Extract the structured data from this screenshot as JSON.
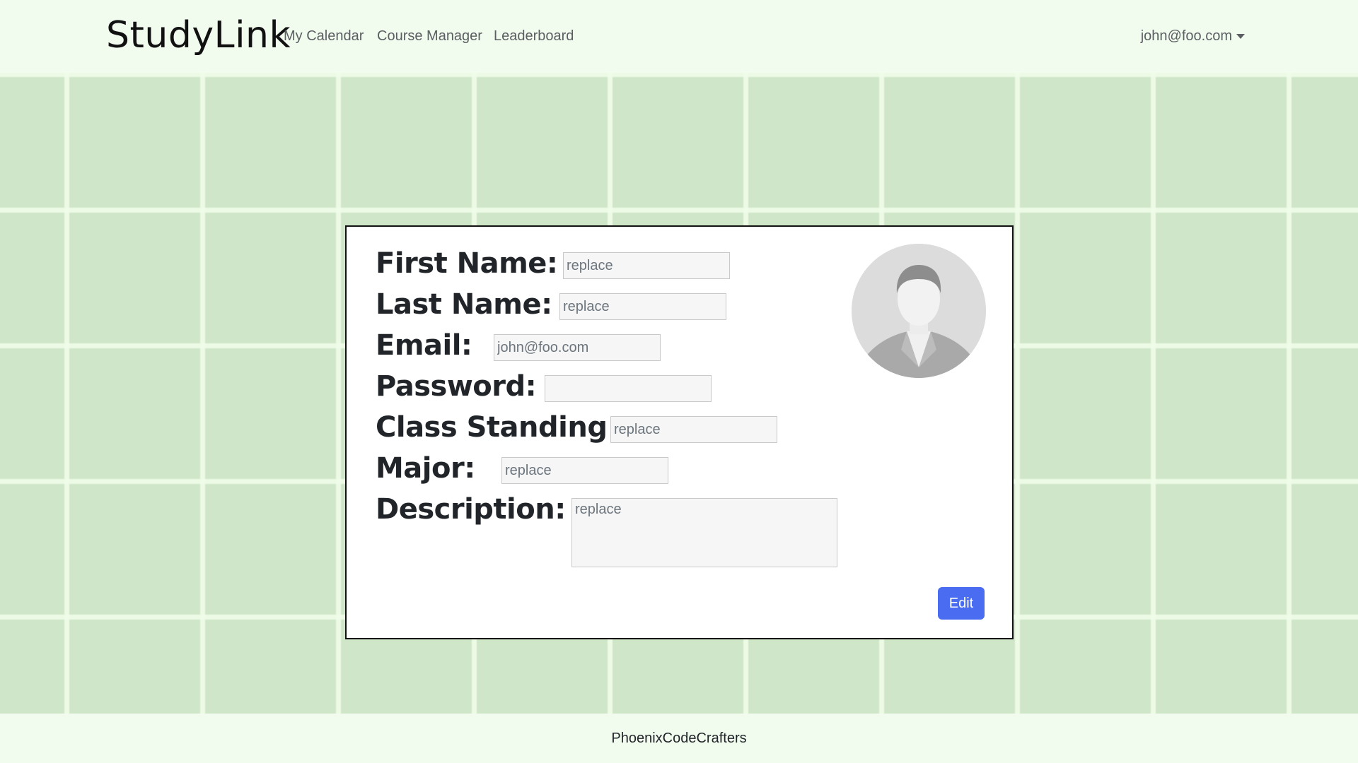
{
  "navbar": {
    "brand": "StudyLink",
    "links": [
      "My Calendar",
      "Course Manager",
      "Leaderboard"
    ],
    "user_menu": "john@foo.com"
  },
  "profile": {
    "fields": {
      "first_name": {
        "label": "First Name:",
        "placeholder": "replace"
      },
      "last_name": {
        "label": "Last Name:",
        "placeholder": "replace"
      },
      "email": {
        "label": "Email:",
        "placeholder": "john@foo.com"
      },
      "password": {
        "label": "Password:",
        "placeholder": ""
      },
      "class_standing": {
        "label": "Class Standing:",
        "placeholder": "replace"
      },
      "major": {
        "label": "Major:",
        "placeholder": "replace"
      },
      "description": {
        "label": "Description:",
        "placeholder": "replace"
      }
    },
    "edit_label": "Edit",
    "avatar_icon": "default-user-avatar"
  },
  "footer": {
    "text": "PhoenixCodeCrafters"
  },
  "colors": {
    "nav_bg": "#f1fcef",
    "page_bg": "#cfe6c8",
    "accent": "#4a6cf0"
  }
}
